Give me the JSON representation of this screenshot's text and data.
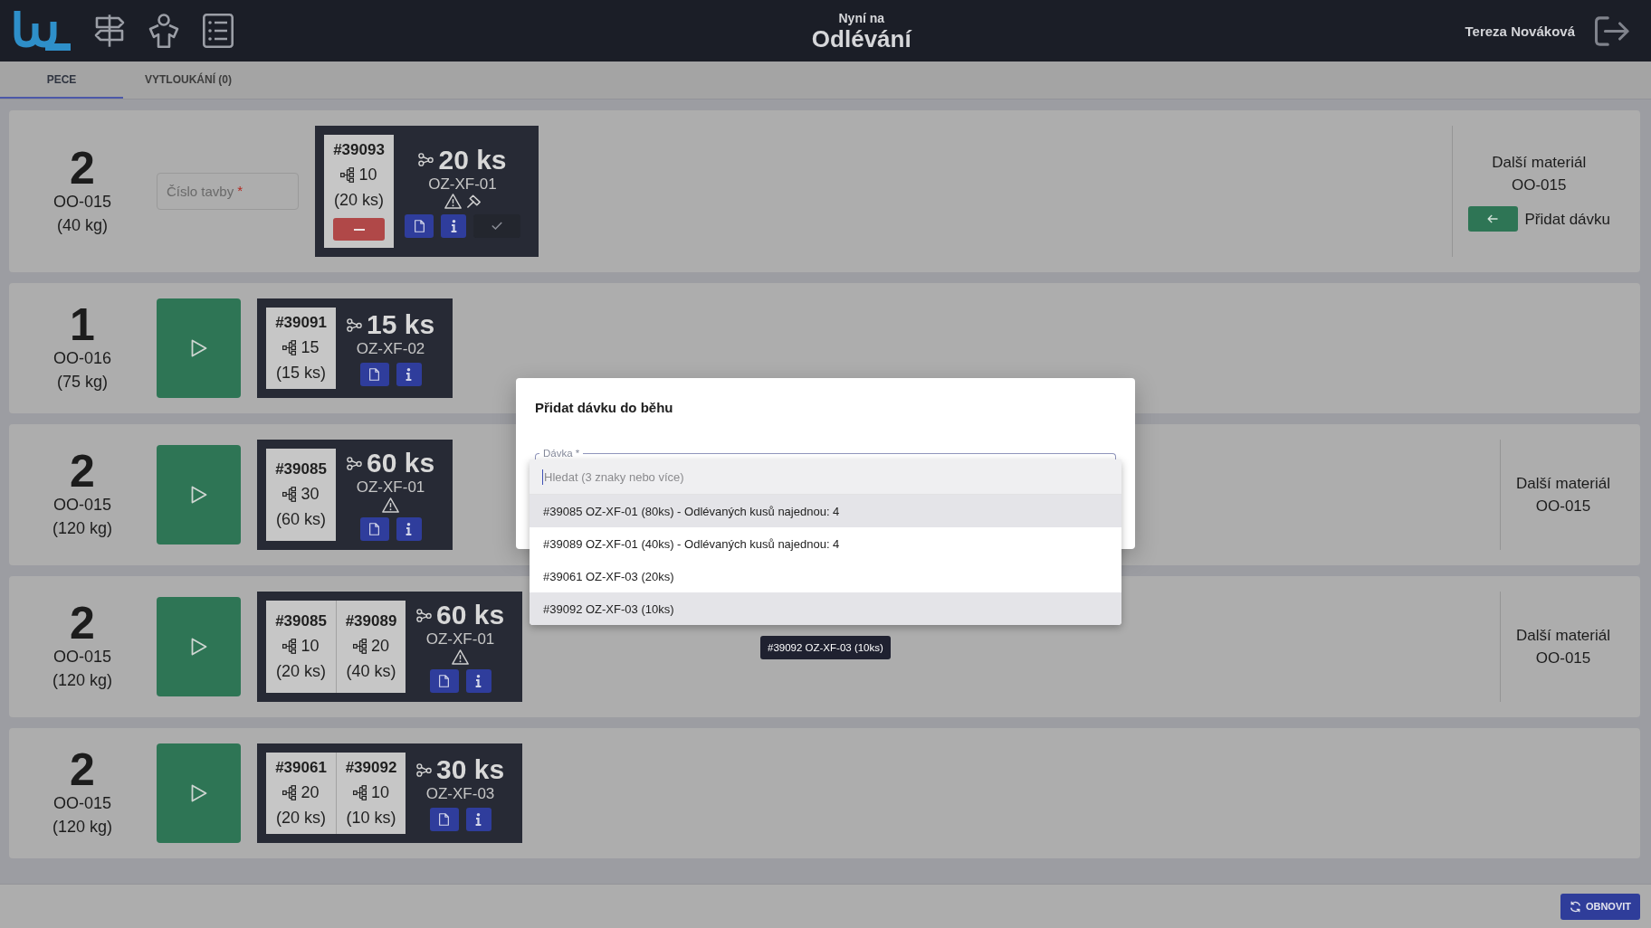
{
  "header": {
    "subtitle": "Nyní na",
    "title": "Odlévání",
    "user": "Tereza Nováková"
  },
  "tabs": [
    {
      "label": "PECE",
      "selected": true
    },
    {
      "label": "VYTLOUKÁNÍ (0)",
      "selected": false
    }
  ],
  "furnaces": [
    {
      "count": "2",
      "material": "OO-015",
      "weight": "(40 kg)",
      "action": {
        "kind": "input",
        "placeholder": "Číslo tavby",
        "required_mark": "*"
      },
      "batch": {
        "lots": [
          {
            "id": "#39093",
            "count": "10",
            "pieces": "(20 ks)",
            "removable": true
          }
        ],
        "total": "20 ks",
        "part": "OZ-XF-01",
        "warning": true,
        "hammer": true,
        "buttons": [
          {
            "kind": "document"
          },
          {
            "kind": "info"
          },
          {
            "kind": "confirm"
          }
        ]
      },
      "next": {
        "label": "Další materiál",
        "material": "OO-015",
        "add_label": "Přidat dávku"
      }
    },
    {
      "count": "1",
      "material": "OO-016",
      "weight": "(75 kg)",
      "action": {
        "kind": "start"
      },
      "batch": {
        "lots": [
          {
            "id": "#39091",
            "count": "15",
            "pieces": "(15 ks)",
            "removable": false
          }
        ],
        "total": "15 ks",
        "part": "OZ-XF-02",
        "warning": false,
        "hammer": false,
        "buttons": [
          {
            "kind": "document"
          },
          {
            "kind": "info"
          }
        ]
      }
    },
    {
      "count": "2",
      "material": "OO-015",
      "weight": "(120 kg)",
      "action": {
        "kind": "start"
      },
      "batch": {
        "lots": [
          {
            "id": "#39085",
            "count": "30",
            "pieces": "(60 ks)",
            "removable": false
          }
        ],
        "total": "60 ks",
        "part": "OZ-XF-01",
        "warning": true,
        "hammer": false,
        "buttons": [
          {
            "kind": "document"
          },
          {
            "kind": "info"
          }
        ]
      },
      "next": {
        "label": "Další materiál",
        "material": "OO-015"
      }
    },
    {
      "count": "2",
      "material": "OO-015",
      "weight": "(120 kg)",
      "action": {
        "kind": "start"
      },
      "batch": {
        "lots": [
          {
            "id": "#39085",
            "count": "10",
            "pieces": "(20 ks)",
            "removable": false
          },
          {
            "id": "#39089",
            "count": "20",
            "pieces": "(40 ks)",
            "removable": false
          }
        ],
        "total": "60 ks",
        "part": "OZ-XF-01",
        "warning": true,
        "hammer": false,
        "buttons": [
          {
            "kind": "document"
          },
          {
            "kind": "info"
          }
        ]
      },
      "next": {
        "label": "Další materiál",
        "material": "OO-015"
      }
    },
    {
      "count": "2",
      "material": "OO-015",
      "weight": "(120 kg)",
      "action": {
        "kind": "start"
      },
      "batch": {
        "lots": [
          {
            "id": "#39061",
            "count": "20",
            "pieces": "(20 ks)",
            "removable": false
          },
          {
            "id": "#39092",
            "count": "10",
            "pieces": "(10 ks)",
            "removable": false
          }
        ],
        "total": "30 ks",
        "part": "OZ-XF-03",
        "warning": false,
        "hammer": false,
        "buttons": [
          {
            "kind": "document"
          },
          {
            "kind": "info"
          }
        ]
      }
    }
  ],
  "dialog": {
    "title": "Přidat dávku do běhu",
    "field_label": "Dávka",
    "required_mark": "*",
    "search_placeholder": "Hledat (3 znaky nebo více)",
    "options": [
      {
        "label": "#39085 OZ-XF-01 (80ks) - Odlévaných kusů najednou: 4",
        "highlighted": true
      },
      {
        "label": "#39089 OZ-XF-01 (40ks) - Odlévaných kusů najednou: 4",
        "highlighted": false
      },
      {
        "label": "#39061 OZ-XF-03 (20ks)",
        "highlighted": false
      },
      {
        "label": "#39092 OZ-XF-03 (10ks)",
        "highlighted": true
      }
    ],
    "tooltip": "#39092 OZ-XF-03 (10ks)"
  },
  "footer": {
    "refresh_label": "OBNOVIT"
  }
}
